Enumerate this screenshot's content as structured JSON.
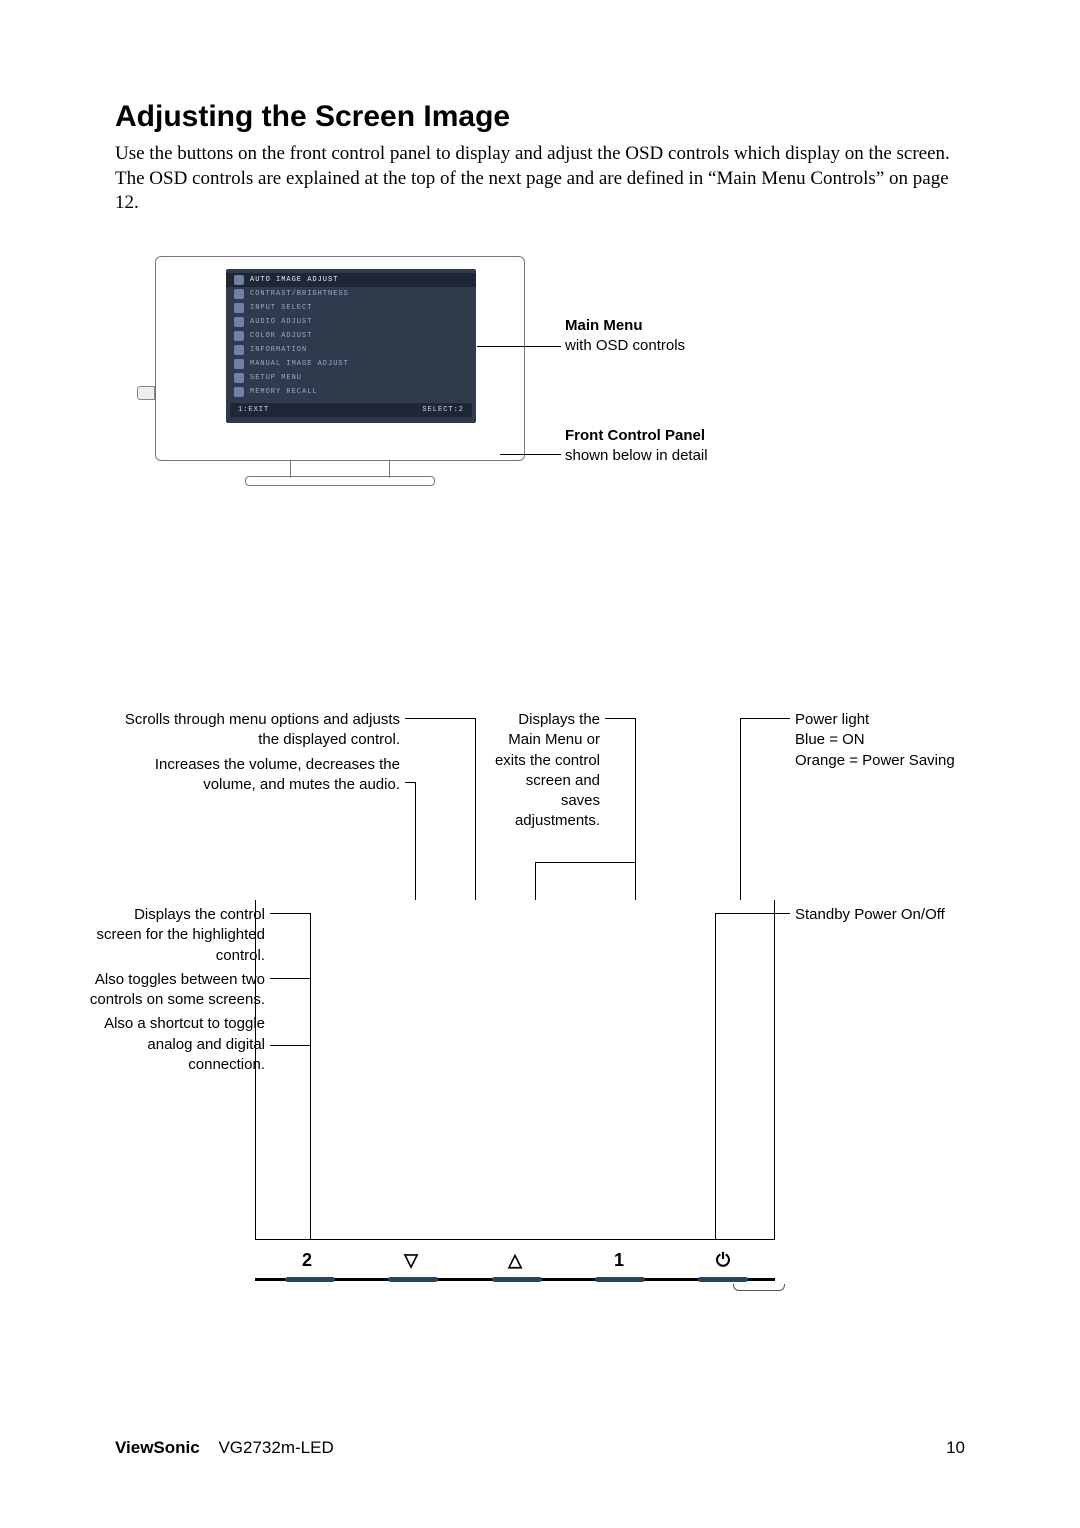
{
  "heading": "Adjusting the Screen Image",
  "intro": "Use the buttons on the front control panel to display and adjust the OSD controls which display on the screen. The OSD controls are explained at the top of the next page and are defined in “Main Menu Controls” on page 12.",
  "osd": {
    "items": [
      "AUTO IMAGE ADJUST",
      "CONTRAST/BRIGHTNESS",
      "INPUT SELECT",
      "AUDIO ADJUST",
      "COLOR ADJUST",
      "INFORMATION",
      "MANUAL IMAGE ADJUST",
      "SETUP MENU",
      "MEMORY RECALL"
    ],
    "footer_left": "1:EXIT",
    "footer_right": "SELECT:2"
  },
  "fig_captions": {
    "main_menu_title": "Main Menu",
    "main_menu_sub": "with OSD controls",
    "front_panel_title": "Front Control Panel",
    "front_panel_sub": "shown below in detail"
  },
  "callouts": {
    "scrolls_a": "Scrolls through menu options and adjusts the displayed control.",
    "scrolls_b": "Increases the volume, decreases the volume, and mutes the audio.",
    "displays_a": "Displays the control screen for the highlighted control.",
    "displays_b": "Also toggles between two controls on some screens.",
    "displays_c": "Also a shortcut to toggle analog and digital connection.",
    "button1": "Displays the Main Menu or exits the control screen and saves adjustments.",
    "power_light_a": "Power light",
    "power_light_b": "Blue = ON",
    "power_light_c": "Orange = Power Saving",
    "standby": "Standby Power On/Off"
  },
  "panel_buttons": [
    "2",
    "▽",
    "△",
    "1",
    "⏻"
  ],
  "footer": {
    "brand": "ViewSonic",
    "model": "VG2732m-LED",
    "page": "10"
  }
}
